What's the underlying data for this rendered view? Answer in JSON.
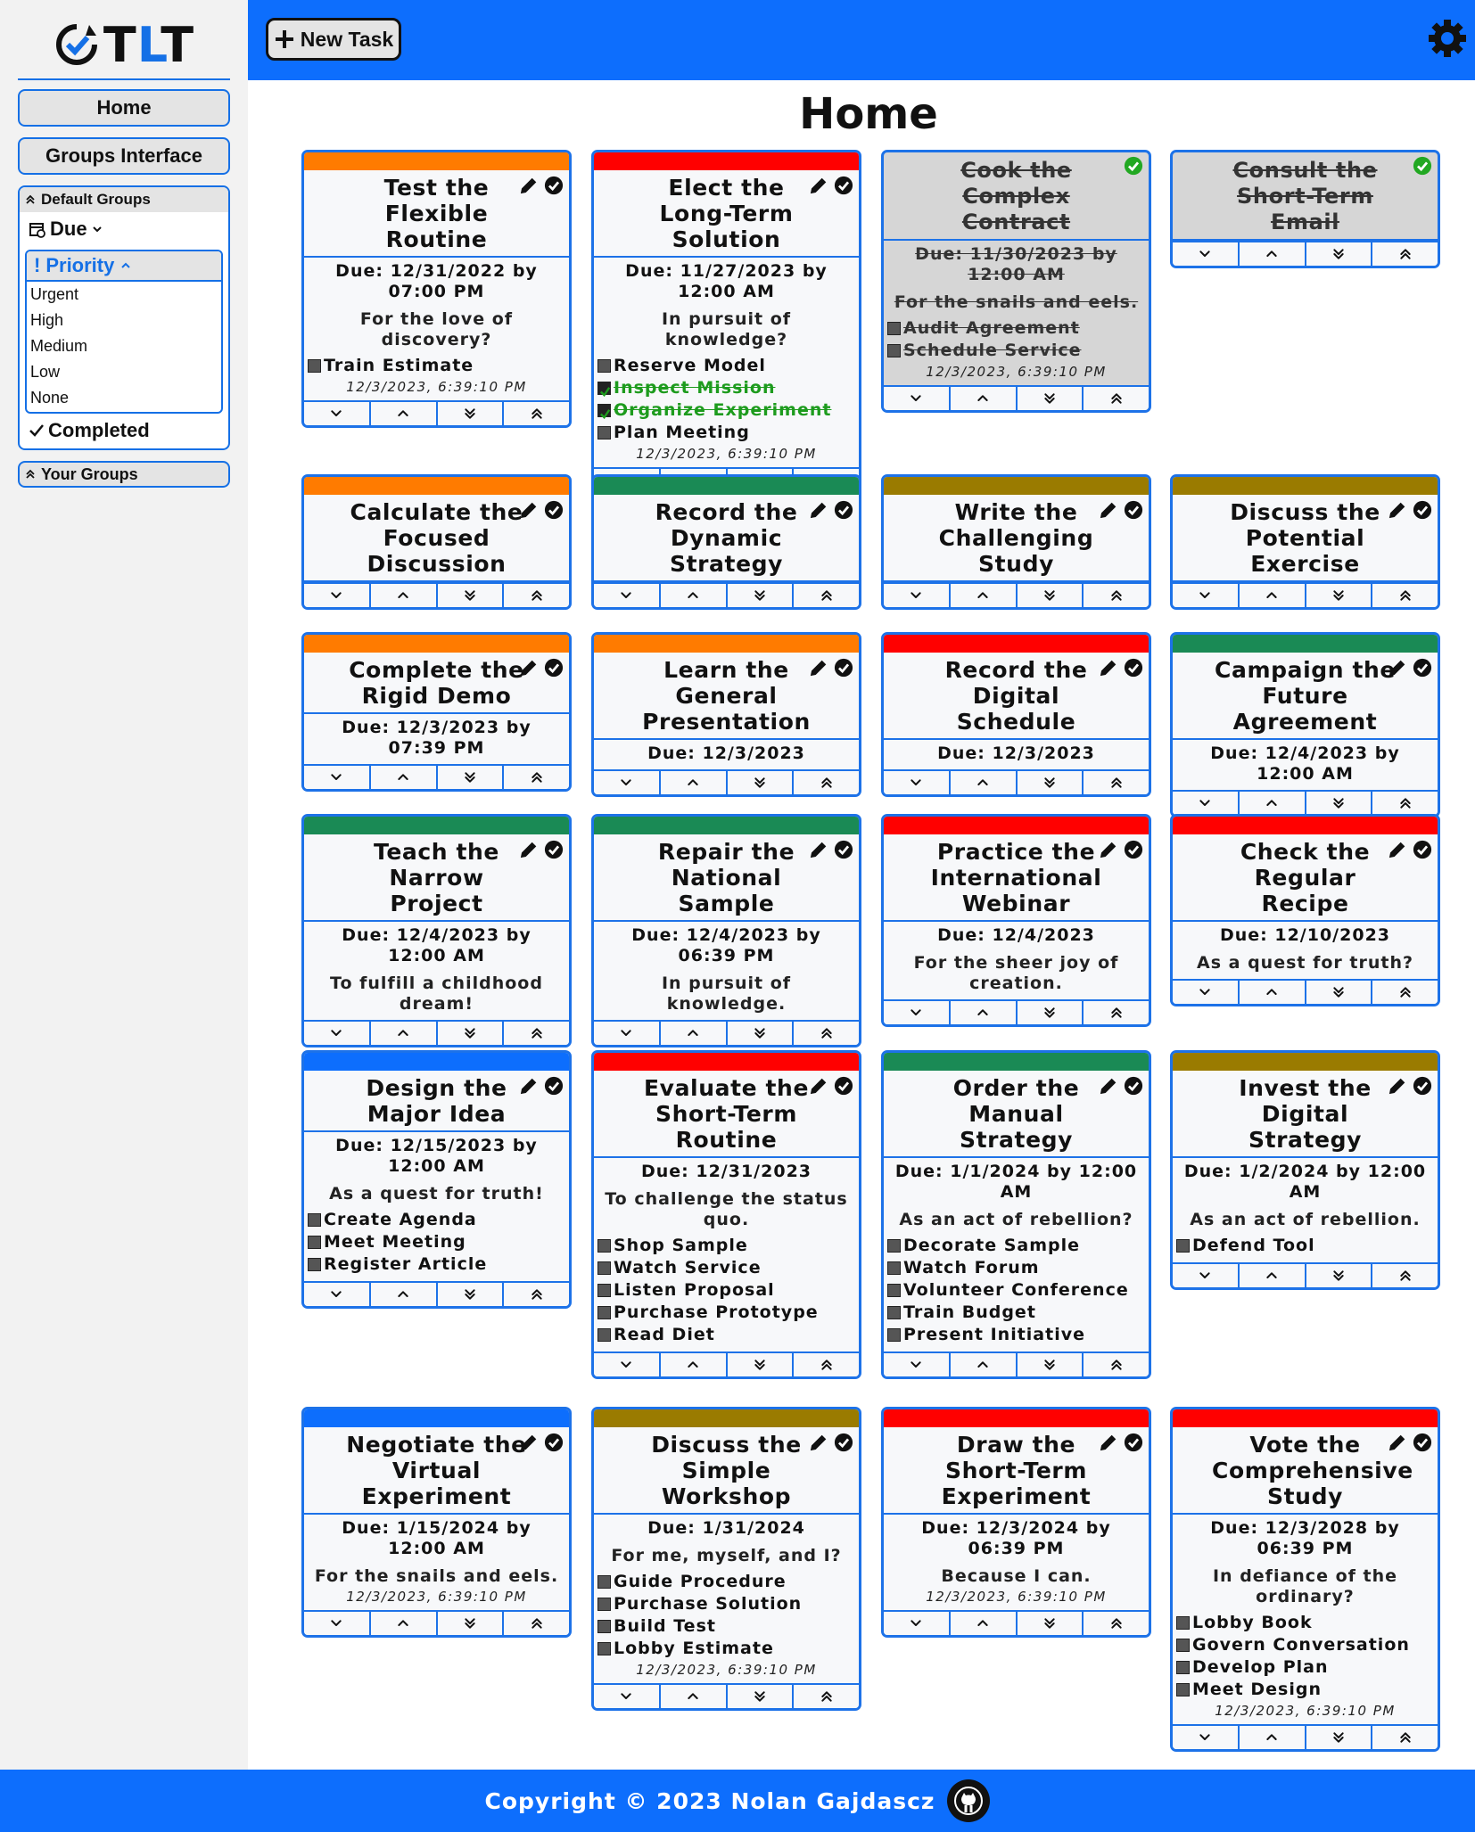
{
  "app": {
    "logo_text_1": "T",
    "logo_text_2": "L",
    "logo_text_3": "T"
  },
  "sidebar": {
    "home": "Home",
    "groups_interface": "Groups Interface",
    "default_groups": "Default Groups",
    "due": "Due",
    "priority": "Priority",
    "priority_options": [
      "Urgent",
      "High",
      "Medium",
      "Low",
      "None"
    ],
    "completed": "Completed",
    "your_groups": "Your Groups"
  },
  "topbar": {
    "new_task": "New Task"
  },
  "page": {
    "title": "Home"
  },
  "colors": {
    "urgent": "#ff0000",
    "high": "#ff7b00",
    "medium": "#9a7b00",
    "low": "#1a8a55",
    "none": "#0d6efd",
    "accent": "#0d6efd"
  },
  "cards": [
    {
      "title": "Test the Flexible Routine",
      "priority": "high",
      "due": "Due: 12/31/2022 by 07:00 PM",
      "desc": "For the love of discovery?",
      "subtasks": [
        {
          "label": "Train Estimate",
          "done": false
        }
      ],
      "timestamp": "12/3/2023, 6:39:10 PM",
      "completed": false
    },
    {
      "title": "Elect the Long-Term Solution",
      "priority": "urgent",
      "due": "Due: 11/27/2023 by 12:00 AM",
      "desc": "In pursuit of knowledge?",
      "subtasks": [
        {
          "label": "Reserve Model",
          "done": false
        },
        {
          "label": "Inspect Mission",
          "done": true
        },
        {
          "label": "Organize Experiment",
          "done": true
        },
        {
          "label": "Plan Meeting",
          "done": false
        }
      ],
      "timestamp": "12/3/2023, 6:39:10 PM",
      "completed": false
    },
    {
      "title": "Cook the Complex Contract",
      "priority": "completed",
      "due": "Due: 11/30/2023 by 12:00 AM",
      "desc": "For the snails and eels.",
      "subtasks": [
        {
          "label": "Audit Agreement",
          "done": false
        },
        {
          "label": "Schedule Service",
          "done": false
        }
      ],
      "timestamp": "12/3/2023, 6:39:10 PM",
      "completed": true
    },
    {
      "title": "Consult the Short-Term Email",
      "priority": "completed",
      "due": "",
      "desc": "",
      "subtasks": [],
      "timestamp": "",
      "completed": true
    },
    {
      "title": "Calculate the Focused Discussion",
      "priority": "high",
      "due": "",
      "desc": "",
      "subtasks": [],
      "timestamp": "",
      "completed": false
    },
    {
      "title": "Record the Dynamic Strategy",
      "priority": "low",
      "due": "",
      "desc": "",
      "subtasks": [],
      "timestamp": "",
      "completed": false
    },
    {
      "title": "Write the Challenging Study",
      "priority": "medium",
      "due": "",
      "desc": "",
      "subtasks": [],
      "timestamp": "",
      "completed": false
    },
    {
      "title": "Discuss the Potential Exercise",
      "priority": "medium",
      "due": "",
      "desc": "",
      "subtasks": [],
      "timestamp": "",
      "completed": false
    },
    {
      "title": "Complete the Rigid Demo",
      "priority": "high",
      "due": "Due: 12/3/2023 by 07:39 PM",
      "desc": "",
      "subtasks": [],
      "timestamp": "",
      "completed": false
    },
    {
      "title": "Learn the General Presentation",
      "priority": "high",
      "due": "Due: 12/3/2023",
      "desc": "",
      "subtasks": [],
      "timestamp": "",
      "completed": false
    },
    {
      "title": "Record the Digital Schedule",
      "priority": "urgent",
      "due": "Due: 12/3/2023",
      "desc": "",
      "subtasks": [],
      "timestamp": "",
      "completed": false
    },
    {
      "title": "Campaign the Future Agreement",
      "priority": "low",
      "due": "Due: 12/4/2023 by 12:00 AM",
      "desc": "",
      "subtasks": [],
      "timestamp": "",
      "completed": false
    },
    {
      "title": "Teach the Narrow Project",
      "priority": "low",
      "due": "Due: 12/4/2023 by 12:00 AM",
      "desc": "To fulfill a childhood dream!",
      "subtasks": [],
      "timestamp": "",
      "completed": false
    },
    {
      "title": "Repair the National Sample",
      "priority": "low",
      "due": "Due: 12/4/2023 by 06:39 PM",
      "desc": "In pursuit of knowledge.",
      "subtasks": [],
      "timestamp": "",
      "completed": false
    },
    {
      "title": "Practice the International Webinar",
      "priority": "urgent",
      "due": "Due: 12/4/2023",
      "desc": "For the sheer joy of creation.",
      "subtasks": [],
      "timestamp": "",
      "completed": false
    },
    {
      "title": "Check the Regular Recipe",
      "priority": "urgent",
      "due": "Due: 12/10/2023",
      "desc": "As a quest for truth?",
      "subtasks": [],
      "timestamp": "",
      "completed": false
    },
    {
      "title": "Design the Major Idea",
      "priority": "none",
      "due": "Due: 12/15/2023 by 12:00 AM",
      "desc": "As a quest for truth!",
      "subtasks": [
        {
          "label": "Create Agenda",
          "done": false
        },
        {
          "label": "Meet Meeting",
          "done": false
        },
        {
          "label": "Register Article",
          "done": false
        }
      ],
      "timestamp": "",
      "completed": false
    },
    {
      "title": "Evaluate the Short-Term Routine",
      "priority": "urgent",
      "due": "Due: 12/31/2023",
      "desc": "To challenge the status quo.",
      "subtasks": [
        {
          "label": "Shop Sample",
          "done": false
        },
        {
          "label": "Watch Service",
          "done": false
        },
        {
          "label": "Listen Proposal",
          "done": false
        },
        {
          "label": "Purchase Prototype",
          "done": false
        },
        {
          "label": "Read Diet",
          "done": false
        }
      ],
      "timestamp": "",
      "completed": false
    },
    {
      "title": "Order the Manual Strategy",
      "priority": "low",
      "due": "Due: 1/1/2024 by 12:00 AM",
      "desc": "As an act of rebellion?",
      "subtasks": [
        {
          "label": "Decorate Sample",
          "done": false
        },
        {
          "label": "Watch Forum",
          "done": false
        },
        {
          "label": "Volunteer Conference",
          "done": false
        },
        {
          "label": "Train Budget",
          "done": false
        },
        {
          "label": "Present Initiative",
          "done": false
        }
      ],
      "timestamp": "",
      "completed": false
    },
    {
      "title": "Invest the Digital Strategy",
      "priority": "medium",
      "due": "Due: 1/2/2024 by 12:00 AM",
      "desc": "As an act of rebellion.",
      "subtasks": [
        {
          "label": "Defend Tool",
          "done": false
        }
      ],
      "timestamp": "",
      "completed": false
    },
    {
      "title": "Negotiate the Virtual Experiment",
      "priority": "none",
      "due": "Due: 1/15/2024 by 12:00 AM",
      "desc": "For the snails and eels.",
      "subtasks": [],
      "timestamp": "12/3/2023, 6:39:10 PM",
      "completed": false
    },
    {
      "title": "Discuss the Simple Workshop",
      "priority": "medium",
      "due": "Due: 1/31/2024",
      "desc": "For me, myself, and I?",
      "subtasks": [
        {
          "label": "Guide Procedure",
          "done": false
        },
        {
          "label": "Purchase Solution",
          "done": false
        },
        {
          "label": "Build Test",
          "done": false
        },
        {
          "label": "Lobby Estimate",
          "done": false
        }
      ],
      "timestamp": "12/3/2023, 6:39:10 PM",
      "completed": false
    },
    {
      "title": "Draw the Short-Term Experiment",
      "priority": "urgent",
      "due": "Due: 12/3/2024 by 06:39 PM",
      "desc": "Because I can.",
      "subtasks": [],
      "timestamp": "12/3/2023, 6:39:10 PM",
      "completed": false
    },
    {
      "title": "Vote the Comprehensive Study",
      "priority": "urgent",
      "due": "Due: 12/3/2028 by 06:39 PM",
      "desc": "In defiance of the ordinary?",
      "subtasks": [
        {
          "label": "Lobby Book",
          "done": false
        },
        {
          "label": "Govern Conversation",
          "done": false
        },
        {
          "label": "Develop Plan",
          "done": false
        },
        {
          "label": "Meet Design",
          "done": false
        }
      ],
      "timestamp": "12/3/2023, 6:39:10 PM",
      "completed": false
    }
  ],
  "footer": {
    "copyright": "Copyright © 2023 Nolan Gajdascz"
  },
  "icons": {
    "pencil": "pencil-icon",
    "check": "check-circle-icon",
    "chevron_down": "chevron-down-icon",
    "chevron_up": "chevron-up-icon",
    "double_down": "double-chevron-down-icon",
    "double_up": "double-chevron-up-icon",
    "gear": "gear-icon",
    "github": "github-icon"
  }
}
